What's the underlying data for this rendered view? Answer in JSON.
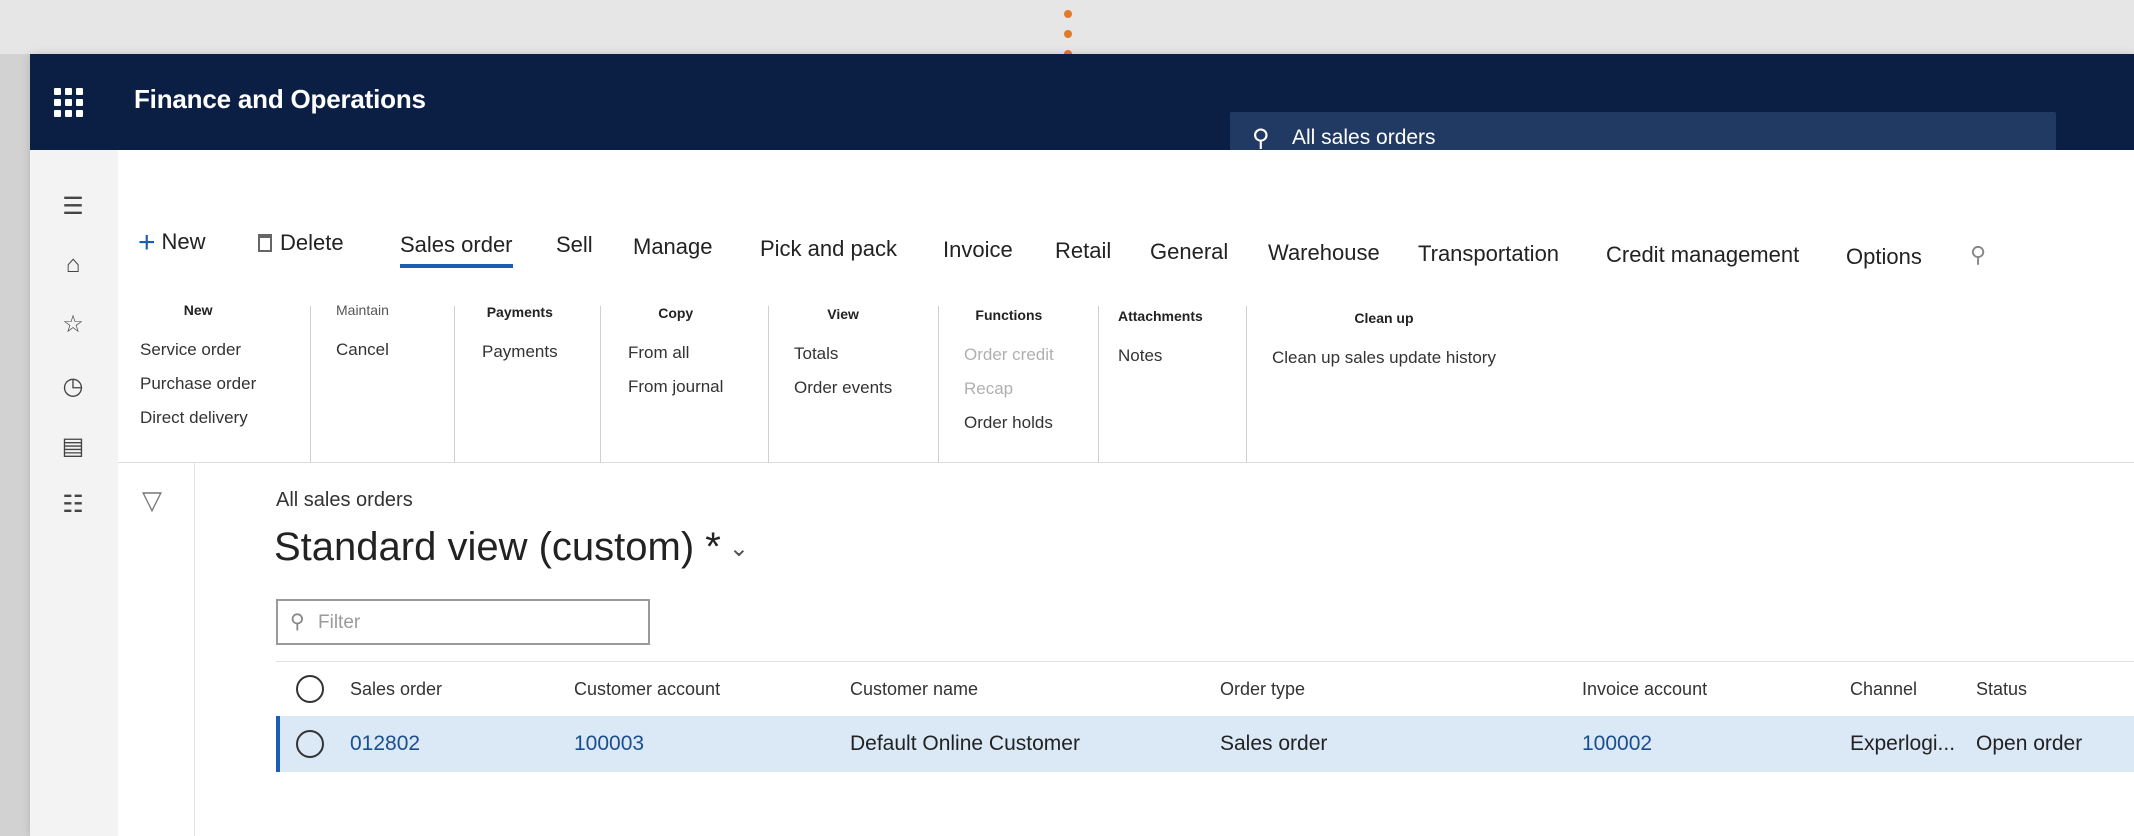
{
  "app": {
    "title": "Finance and Operations"
  },
  "search": {
    "text": "All sales orders",
    "icon": "search-icon"
  },
  "nav": {
    "icons": [
      "hamburger-icon",
      "home-icon",
      "star-icon",
      "clock-icon",
      "workspace-icon",
      "list-icon"
    ]
  },
  "ribbon": {
    "new_label": "New",
    "delete_label": "Delete",
    "tabs": [
      "Sales order",
      "Sell",
      "Manage",
      "Pick and pack",
      "Invoice",
      "Retail",
      "General",
      "Warehouse",
      "Transportation",
      "Credit management",
      "Options"
    ],
    "active_tab": "Sales order",
    "groups": {
      "new": {
        "title": "New",
        "items": [
          "Service order",
          "Purchase order",
          "Direct delivery"
        ]
      },
      "maintain": {
        "title": "Maintain",
        "items": [
          "Cancel"
        ]
      },
      "payments": {
        "title": "Payments",
        "items": [
          "Payments"
        ]
      },
      "copy": {
        "title": "Copy",
        "items": [
          "From all",
          "From journal"
        ]
      },
      "view": {
        "title": "View",
        "items": [
          "Totals",
          "Order events"
        ]
      },
      "functions": {
        "title": "Functions",
        "items": [
          "Order credit",
          "Recap",
          "Order holds"
        ]
      },
      "attachments": {
        "title": "Attachments",
        "items": [
          "Notes"
        ]
      },
      "cleanup": {
        "title": "Clean up",
        "items": [
          "Clean up sales update history"
        ]
      }
    }
  },
  "page": {
    "breadcrumb": "All sales orders",
    "view_title": "Standard view (custom)",
    "view_modified": "*",
    "filter_placeholder": "Filter"
  },
  "grid": {
    "columns": [
      "Sales order",
      "Customer account",
      "Customer name",
      "Order type",
      "Invoice account",
      "Channel",
      "Status"
    ],
    "rows": [
      [
        "012802",
        "100003",
        "Default Online Customer",
        "Sales order",
        "100002",
        "Experlogi...",
        "Open order"
      ]
    ]
  },
  "colors": {
    "topbar": "#0b1f45",
    "accent": "#1a5fb4",
    "selected_row": "#dbe8f6",
    "marker": "#e07a2f"
  }
}
